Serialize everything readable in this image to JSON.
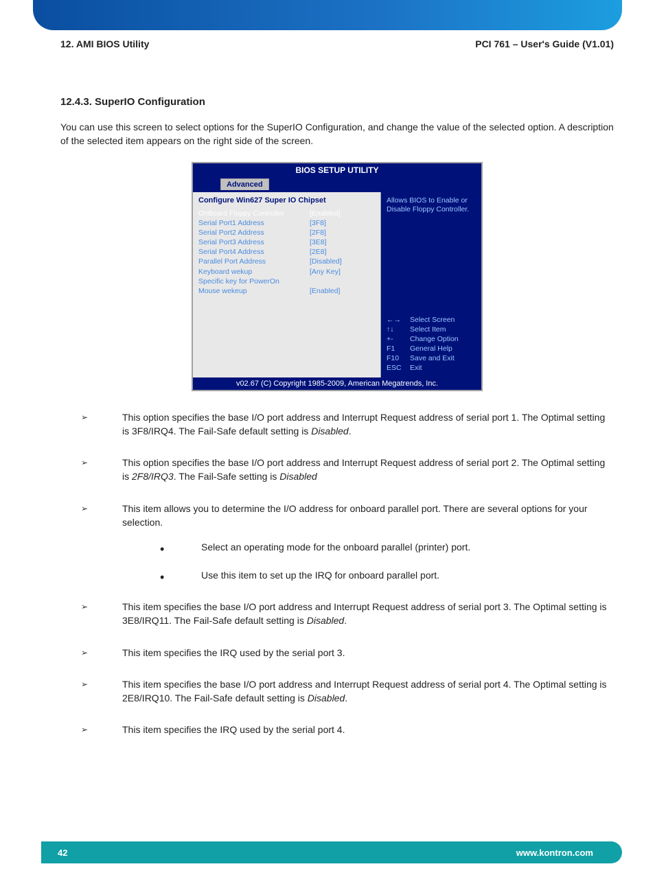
{
  "header": {
    "left": "12. AMI BIOS Utility",
    "right": "PCI 761 – User's Guide (V1.01)"
  },
  "section": {
    "heading": "12.4.3. SuperIO Configuration",
    "intro": "You can use this screen to select options for the SuperIO Configuration, and change the value of the selected option. A description of the selected item appears on the right side of the screen."
  },
  "bios": {
    "title": "BIOS SETUP UTILITY",
    "tab": "Advanced",
    "configTitle": "Configure Win627  Super IO Chipset",
    "rows": [
      {
        "label": "OnBoard Floppy Controller",
        "value": "[Enabled]",
        "selected": true
      },
      {
        "label": "Serial Port1 Address",
        "value": "[3F8]"
      },
      {
        "label": "Serial Port2 Address",
        "value": "[2F8]"
      },
      {
        "label": "Serial Port3 Address",
        "value": "[3E8]"
      },
      {
        "label": "Serial Port4 Address",
        "value": "[2E8]"
      },
      {
        "label": "Parallel Port Address",
        "value": "[Disabled]"
      },
      {
        "label": "Keyboard wekup",
        "value": "[Any Key]"
      },
      {
        "label": "Specific key for PowerOn",
        "value": ""
      },
      {
        "label": "Mouse wekeup",
        "value": "[Enabled]"
      }
    ],
    "desc": "Allows BIOS to Enable or Disable Floppy Controller.",
    "help": [
      {
        "key": "←→",
        "action": "Select Screen"
      },
      {
        "key": "↑↓",
        "action": "Select Item"
      },
      {
        "key": "+-",
        "action": "Change Option"
      },
      {
        "key": "F1",
        "action": "General Help"
      },
      {
        "key": "F10",
        "action": "Save and Exit"
      },
      {
        "key": "ESC",
        "action": "Exit"
      }
    ],
    "footer": "v02.67 (C) Copyright 1985-2009, American Megatrends, Inc."
  },
  "definitions": {
    "item1": {
      "pre": "This option specifies the base I/O port address and Interrupt Request address of serial port 1. The Optimal setting is 3F8/IRQ4. The Fail-Safe default setting is ",
      "ital": "Disabled",
      "post": "."
    },
    "item2": {
      "pre": "This option specifies the base I/O port address and Interrupt Request address of serial port 2. The Optimal setting is ",
      "ital1": "2F8/IRQ3",
      "mid": ". The Fail-Safe setting is ",
      "ital2": "Disabled"
    },
    "item3": "This item allows you to determine the I/O address for onboard parallel port. There are several options for your selection.",
    "sub1": "Select an operating mode for the onboard parallel (printer) port.",
    "sub2": "Use this item to set up the IRQ for onboard parallel port.",
    "item4": {
      "pre": "This item specifies the base I/O port address and Interrupt Request address of serial port 3. The Optimal setting is 3E8/IRQ11. The Fail-Safe default setting is ",
      "ital": "Disabled",
      "post": "."
    },
    "item5": "This item specifies the IRQ used by the serial port 3.",
    "item6": {
      "pre": "This item specifies the base I/O port address and Interrupt Request address of serial port 4. The Optimal setting is 2E8/IRQ10. The Fail-Safe default setting is ",
      "ital": "Disabled",
      "post": "."
    },
    "item7": "This item specifies the IRQ used by the serial port 4."
  },
  "footer": {
    "page": "42",
    "url": "www.kontron.com"
  }
}
